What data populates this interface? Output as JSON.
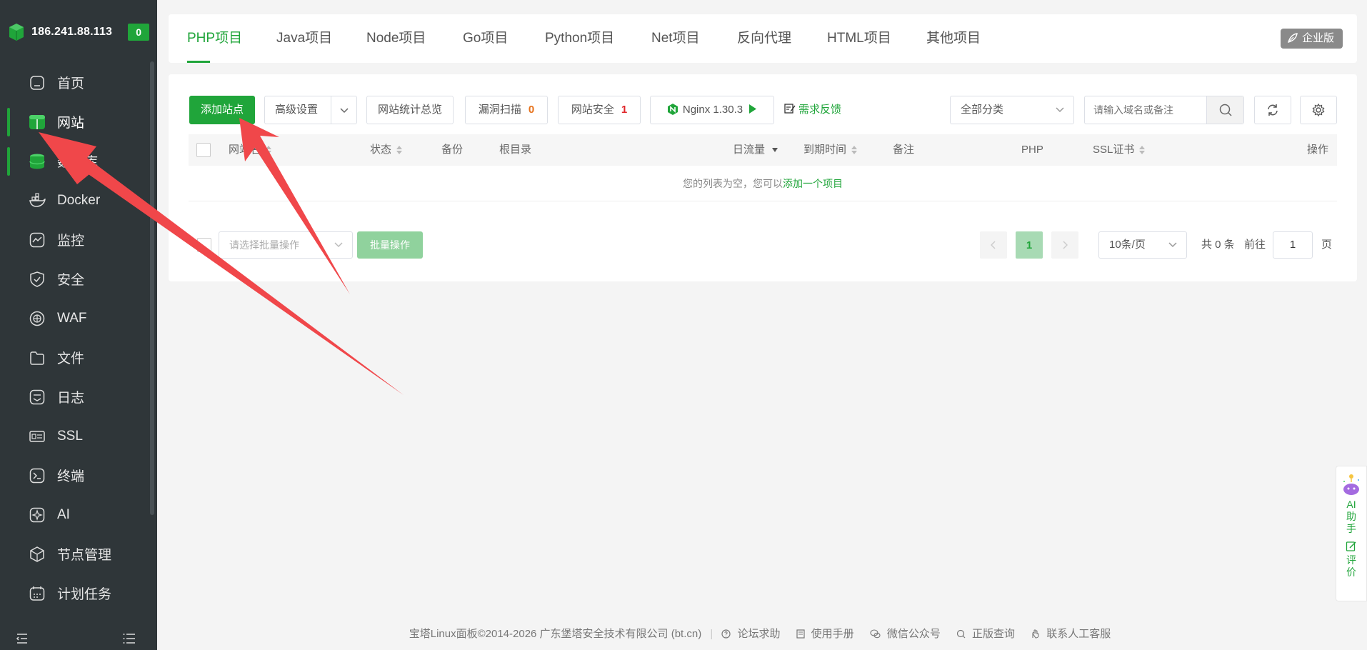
{
  "sidebar": {
    "ip": "186.241.88.113",
    "badge": "0",
    "items": [
      {
        "label": "首页",
        "icon": "home-icon"
      },
      {
        "label": "网站",
        "icon": "website-icon"
      },
      {
        "label": "数据库",
        "icon": "database-icon"
      },
      {
        "label": "Docker",
        "icon": "docker-icon"
      },
      {
        "label": "监控",
        "icon": "monitor-icon"
      },
      {
        "label": "安全",
        "icon": "shield-icon"
      },
      {
        "label": "WAF",
        "icon": "waf-icon"
      },
      {
        "label": "文件",
        "icon": "folder-icon"
      },
      {
        "label": "日志",
        "icon": "log-icon"
      },
      {
        "label": "SSL",
        "icon": "ssl-icon"
      },
      {
        "label": "终端",
        "icon": "terminal-icon"
      },
      {
        "label": "AI",
        "icon": "ai-icon"
      },
      {
        "label": "节点管理",
        "icon": "node-icon"
      },
      {
        "label": "计划任务",
        "icon": "calendar-icon"
      }
    ]
  },
  "tabs": [
    "PHP项目",
    "Java项目",
    "Node项目",
    "Go项目",
    "Python项目",
    "Net项目",
    "反向代理",
    "HTML项目",
    "其他项目"
  ],
  "enterprise": "企业版",
  "toolbar": {
    "add_site": "添加站点",
    "advanced": "高级设置",
    "stats": "网站统计总览",
    "vuln_scan": "漏洞扫描",
    "vuln_count": "0",
    "site_security": "网站安全",
    "security_count": "1",
    "nginx": "Nginx 1.30.3",
    "feedback": "需求反馈",
    "category": "全部分类",
    "search_placeholder": "请输入域名或备注"
  },
  "table": {
    "headers": {
      "site": "网站名",
      "status": "状态",
      "backup": "备份",
      "root": "根目录",
      "traffic": "日流量",
      "expire": "到期时间",
      "note": "备注",
      "php": "PHP",
      "ssl": "SSL证书",
      "ops": "操作"
    },
    "empty_text": "您的列表为空，您可以",
    "empty_link": "添加一个项目"
  },
  "batch": {
    "placeholder": "请选择批量操作",
    "button": "批量操作"
  },
  "pagination": {
    "current": "1",
    "page_size": "10条/页",
    "total": "共 0 条",
    "goto": "前往",
    "page_input": "1",
    "page_unit": "页"
  },
  "footer": {
    "copyright": "宝塔Linux面板©2014-2026 广东堡塔安全技术有限公司 (bt.cn)",
    "links": [
      "论坛求助",
      "使用手册",
      "微信公众号",
      "正版查询",
      "联系人工客服"
    ]
  },
  "float": {
    "ai": "AI助手",
    "rate": "评价"
  },
  "colors": {
    "brand": "#20a53a",
    "sidebar_bg": "#2f3639",
    "arrow": "#f0474a"
  }
}
